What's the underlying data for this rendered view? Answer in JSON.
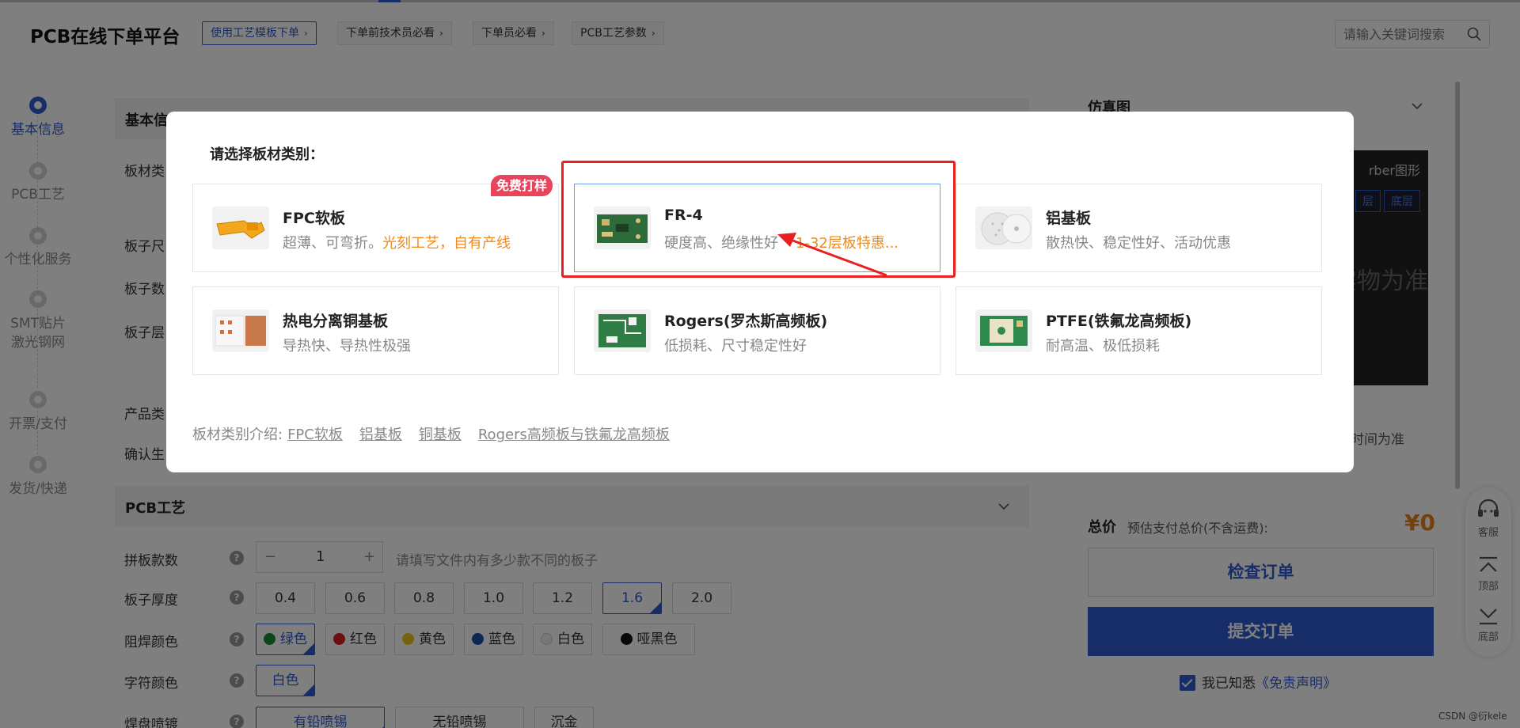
{
  "header": {
    "logo": "PCB在线下单平台",
    "crumbs": [
      "使用工艺模板下单",
      "下单前技术员必看",
      "下单员必看",
      "PCB工艺参数"
    ],
    "crumb_arrow": "›",
    "search_placeholder": "请输入关键词搜索"
  },
  "steps": [
    {
      "label": "基本信息",
      "active": true
    },
    {
      "label": "PCB工艺",
      "active": false
    },
    {
      "label": "个性化服务",
      "active": false
    },
    {
      "label": "SMT贴片",
      "label2": "激光钢网",
      "active": false
    },
    {
      "label": "开票/支付",
      "active": false
    },
    {
      "label": "发货/快递",
      "active": false
    }
  ],
  "form": {
    "basic_section": "基本信息",
    "labels_behind": [
      "板材类",
      "板子尺",
      "板子数",
      "板子层",
      "产品类",
      "确认生"
    ],
    "pcb_section": "PCB工艺",
    "panel_count_label": "拼板款数",
    "panel_count_value": "1",
    "panel_count_minus": "−",
    "panel_count_plus": "+",
    "panel_count_hint": "请填写文件内有多少款不同的板子",
    "thickness_label": "板子厚度",
    "thickness_options": [
      "0.4",
      "0.6",
      "0.8",
      "1.0",
      "1.2",
      "1.6",
      "2.0"
    ],
    "thickness_selected": "1.6",
    "mask_label": "阻焊颜色",
    "mask_options": [
      {
        "label": "绿色",
        "color": "#1a8a3a",
        "selected": true
      },
      {
        "label": "红色",
        "color": "#d6201f",
        "selected": false
      },
      {
        "label": "黄色",
        "color": "#e8c81a",
        "selected": false
      },
      {
        "label": "蓝色",
        "color": "#1d4fa8",
        "selected": false
      },
      {
        "label": "白色",
        "color": "#eeeeee",
        "selected": false
      },
      {
        "label": "哑黑色",
        "color": "#111111",
        "selected": false
      }
    ],
    "silk_label": "字符颜色",
    "silk_value": "白色",
    "pad_label": "焊盘喷镀",
    "pad_options": [
      "有铅喷锡",
      "无铅喷锡",
      "沉金"
    ],
    "help_glyph": "?"
  },
  "right_panel": {
    "title": "仿真图",
    "gerber_label": "rber图形",
    "view_tabs": [
      "层",
      "底层"
    ],
    "overlay_text": "实物为准",
    "note": "生产时间为准",
    "total_label": "总价",
    "total_sub": "预估支付总价(不含运费):",
    "total_value": "¥0",
    "check_button": "检查订单",
    "submit_button": "提交订单",
    "agree_text": "我已知悉",
    "agree_link": "《免责声明》"
  },
  "side_tools": [
    {
      "label": "客服",
      "icon": "headset-icon"
    },
    {
      "label": "顶部",
      "icon": "arrow-up-icon"
    },
    {
      "label": "底部",
      "icon": "arrow-down-icon"
    }
  ],
  "watermark": "CSDN @衍kele",
  "modal": {
    "title": "请选择板材类别：",
    "cards": [
      {
        "name": "FPC软板",
        "desc": "超薄、可弯折。",
        "highlight": "光刻工艺，自有产线",
        "badge": "免费打样",
        "thumb": "fpc"
      },
      {
        "name": "FR-4",
        "desc": "硬度高、绝缘性好",
        "highlight": "1-32层板特惠...",
        "thumb": "fr4",
        "selected": true
      },
      {
        "name": "铝基板",
        "desc": "散热快、稳定性好、活动优惠",
        "thumb": "alu"
      },
      {
        "name": "热电分离铜基板",
        "desc": "导热快、导热性极强",
        "thumb": "copper"
      },
      {
        "name": "Rogers(罗杰斯高频板)",
        "desc": "低损耗、尺寸稳定性好",
        "thumb": "rogers"
      },
      {
        "name": "PTFE(铁氟龙高频板)",
        "desc": "耐高温、极低损耗",
        "thumb": "ptfe"
      }
    ],
    "intro_label": "板材类别介绍:",
    "intro_links": [
      "FPC软板",
      "铝基板",
      "铜基板",
      "Rogers高频板与铁氟龙高频板"
    ]
  },
  "colors": {
    "brand_blue": "#2f5bd1",
    "highlight_orange": "#f08a1c",
    "badge_red": "#e8455d",
    "annotation_red": "#e8201f"
  }
}
